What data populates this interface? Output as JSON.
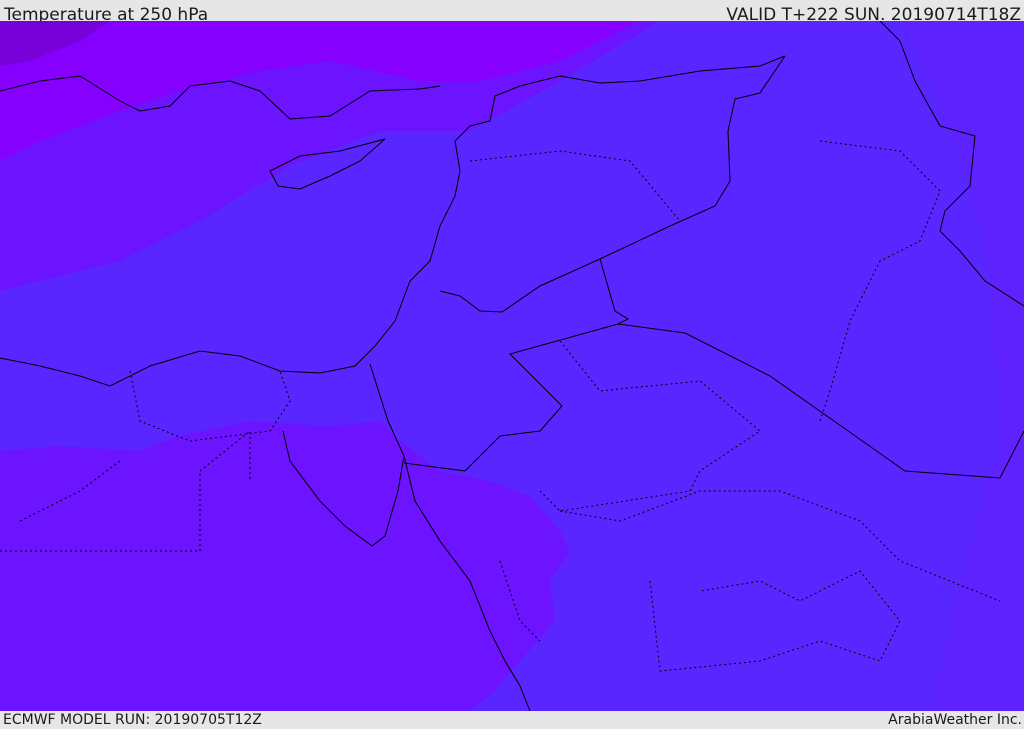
{
  "header": {
    "title": "Temperature at 250 hPa",
    "valid": "VALID T+222 SUN. 20190714T18Z"
  },
  "footer": {
    "model_run": "ECMWF MODEL RUN: 20190705T12Z",
    "brand": "ArabiaWeather Inc."
  },
  "colors": {
    "band_coldest": "#7800d8",
    "band_cold": "#8500ff",
    "band_mid": "#6c14ff",
    "band_warm": "#5a26ff",
    "band_warm2": "#6020ff",
    "coastline": "#000000"
  }
}
